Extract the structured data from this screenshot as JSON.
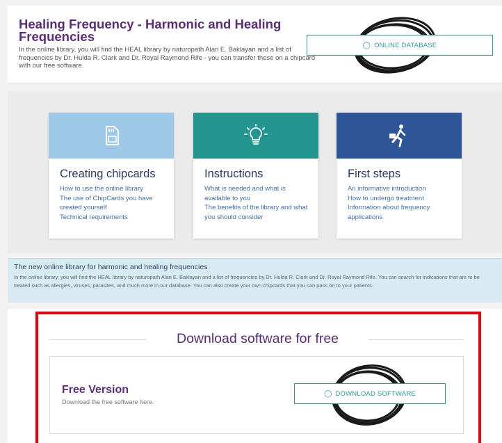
{
  "hero": {
    "title": "Healing Frequency - Harmonic and Healing Frequencies",
    "text": "In the online library, you will find the HEAL library by naturopath Alan E. Baklayan and a list of frequencies by Dr. Hulda R. Clark and Dr. Royal Raymond Rife - you can transfer these on a chipcard with our free software.",
    "button_label": "ONLINE DATABASE",
    "button_icon": "bulb-icon"
  },
  "cards": [
    {
      "title": "Creating chipcards",
      "color": "#9ec8e8",
      "icon": "sd-card-icon",
      "links": [
        "How to use the online library",
        "The use of ChipCards you have created yourself",
        "Technical requirements"
      ]
    },
    {
      "title": "Instructions",
      "color": "#23948e",
      "icon": "bulb-icon",
      "links": [
        "What is needed and what is available to you",
        "The benefits of the library and what you should consider"
      ]
    },
    {
      "title": "First steps",
      "color": "#2e5597",
      "icon": "walking-person-icon",
      "links": [
        "An informative introduction",
        "How to undergo treatment",
        "Information about frequency applications"
      ]
    }
  ],
  "info": {
    "title": "The new online library for harmonic and healing frequencies",
    "text": "In the online library, you will find the HEAL library by naturopath Alan E. Baklayan and a list of frequencies by Dr. Hulda R. Clark and Dr. Royal Raymond Rife. You can search for indications that are to be treated such as allergies, viruses, parasites, and much more in our database. You can also create your own chipcards that you can pass on to your patients."
  },
  "download": {
    "heading": "Download software for free",
    "free_version_title": "Free Version",
    "free_version_sub": "Download the free software here.",
    "button_label": "DOWNLOAD SOFTWARE",
    "button_icon": "bulb-icon"
  },
  "colors": {
    "accent_purple": "#5a2d7a",
    "teal": "#2c9a93",
    "highlight_red": "#e8000f"
  }
}
